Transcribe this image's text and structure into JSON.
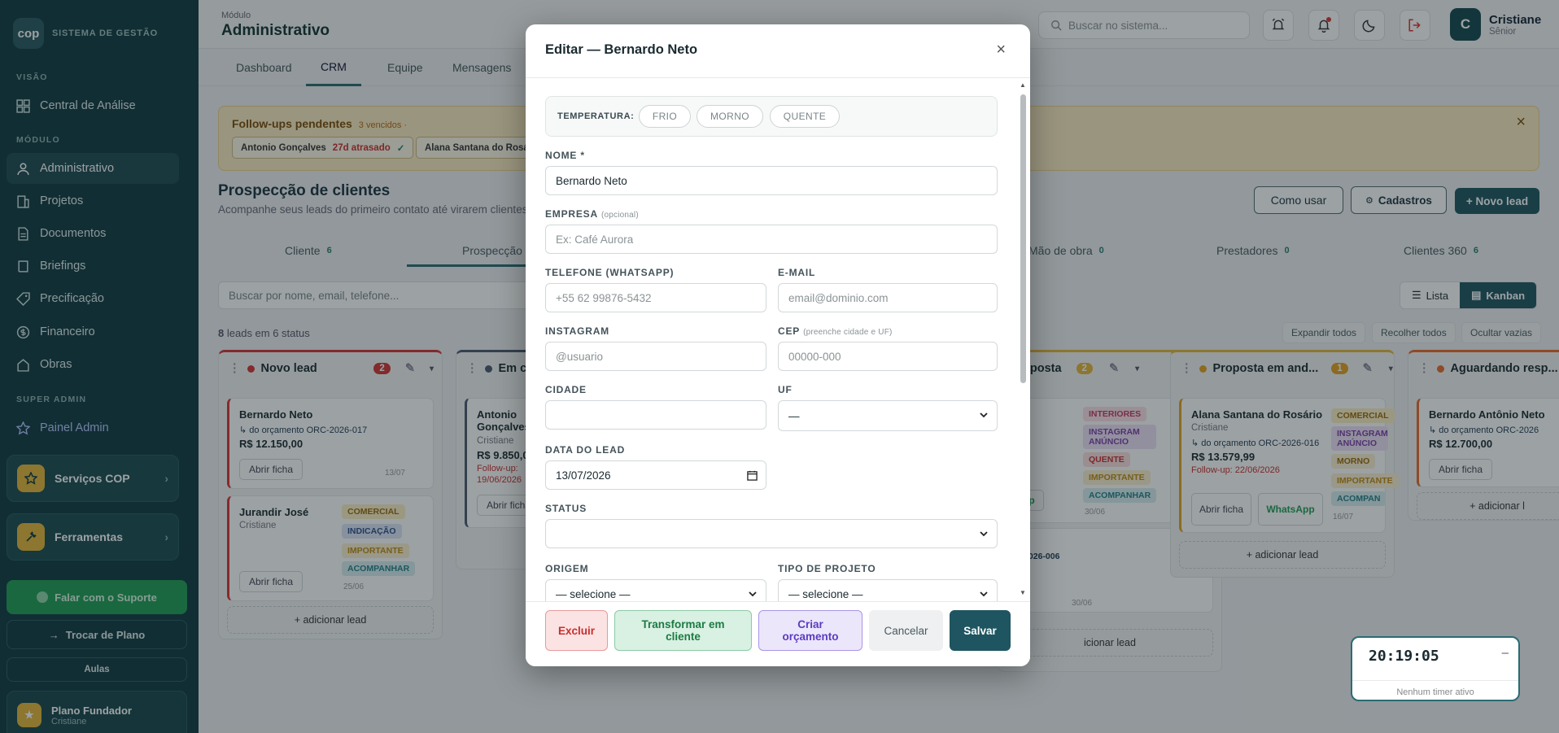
{
  "sidebar": {
    "logo": "cop",
    "logo_sub": "SISTEMA DE GESTÃO",
    "section_visao": "VISÃO",
    "section_modulo": "MÓDULO",
    "section_super": "SUPER ADMIN",
    "items": {
      "central": "Central de Análise",
      "administrativo": "Administrativo",
      "projetos": "Projetos",
      "documentos": "Documentos",
      "briefings": "Briefings",
      "precificacao": "Precificação",
      "financeiro": "Financeiro",
      "obras": "Obras",
      "painel_admin": "Painel Admin"
    },
    "servicos": "Serviços COP",
    "ferramentas": "Ferramentas",
    "suporte": "Falar com o Suporte",
    "trocar_plano": "Trocar de Plano",
    "aulas": "Aulas",
    "plano": "Plano Fundador",
    "plano_user": "Cristiane"
  },
  "topbar": {
    "module_label": "Módulo",
    "module_title": "Administrativo",
    "search_placeholder": "Buscar no sistema...",
    "user_initial": "C",
    "user_name": "Cristiane",
    "user_role": "Sênior"
  },
  "tabs": [
    "Dashboard",
    "CRM",
    "Equipe",
    "Mensagens"
  ],
  "banner": {
    "title": "Follow-ups pendentes",
    "count": "3 vencidos ·",
    "chip1_name": "Antonio Gonçalves",
    "chip1_late": "27d atrasado",
    "chip1_check": "✓",
    "chip2_name": "Alana Santana do Rosário"
  },
  "page": {
    "title": "Prospecção de clientes",
    "subtitle": "Acompanhe seus leads do primeiro contato até virarem clientes",
    "btn_como_usar": "Como usar",
    "btn_cadastros": "Cadastros",
    "btn_novo_lead": "+ Novo lead"
  },
  "stage_tabs": {
    "cliente": "Cliente",
    "cliente_n": "6",
    "prospeccao": "Prospecção",
    "mao_obra": "Mão de obra",
    "mao_obra_n": "0",
    "prestadores": "Prestadores",
    "prestadores_n": "0",
    "clientes360": "Clientes 360",
    "clientes360_n": "6"
  },
  "toolbar": {
    "lead_search": "Buscar por nome, email, telefone...",
    "lista": "Lista",
    "kanban": "Kanban",
    "leads_n": "8",
    "leads_text": "leads em 6 status",
    "expandir": "Expandir todos",
    "recolher": "Recolher todos",
    "ocultar": "Ocultar vazias"
  },
  "kanban": {
    "col1": {
      "title": "Novo lead",
      "count": "2",
      "card1": {
        "name": "Bernardo Neto",
        "origin": "↳ do orçamento ORC-2026-017",
        "value": "R$ 12.150,00",
        "btn": "Abrir ficha",
        "date": "13/07"
      },
      "card2": {
        "name": "Jurandir José",
        "owner": "Cristiane",
        "btn": "Abrir ficha",
        "date": "25/06",
        "tags": [
          "COMERCIAL",
          "INDICAÇÃO",
          "IMPORTANTE",
          "ACOMPANHAR"
        ]
      },
      "add": "+ adicionar lead"
    },
    "col2": {
      "title": "Em co",
      "card_name": "Antonio Gonçalves",
      "owner": "Cristiane",
      "value": "R$ 9.850,0",
      "followup": "Follow-up:",
      "followup_date": "19/06/2026",
      "btn": "Abrir ficha"
    },
    "col3": {
      "title": "oposta",
      "count": "2",
      "tags": [
        "INTERIORES",
        "INSTAGRAM ANÚNCIO",
        "QUENTE",
        "IMPORTANTE",
        "ACOMPANHAR"
      ],
      "btn": "App",
      "date": "30/06",
      "orc": "C-2026-006",
      "date2": "30/06",
      "add": "icionar lead"
    },
    "col4": {
      "title": "Proposta em and...",
      "count": "1",
      "card": {
        "name": "Alana Santana do Rosário",
        "owner": "Cristiane",
        "origin": "↳ do orçamento ORC-2026-016",
        "value": "R$ 13.579,99",
        "followup": "Follow-up: 22/06/2026",
        "btn": "Abrir ficha",
        "btn2": "WhatsApp",
        "date": "16/07",
        "tags": [
          "COMERCIAL",
          "INSTAGRAM ANÚNCIO",
          "MORNO",
          "IMPORTANTE",
          "ACOMPAN"
        ]
      },
      "add": "+ adicionar lead"
    },
    "col5": {
      "title": "Aguardando resp...",
      "card": {
        "name": "Bernardo Antônio Neto",
        "origin": "↳ do orçamento ORC-2026",
        "value": "R$ 12.700,00",
        "btn": "Abrir ficha"
      },
      "add": "+ adicionar l"
    }
  },
  "timer": {
    "time": "20:19:05",
    "status": "Nenhum timer ativo",
    "min": "–"
  },
  "modal": {
    "title": "Editar — Bernardo Neto",
    "close": "×",
    "temperatura_label": "TEMPERATURA:",
    "temp_frio": "FRIO",
    "temp_morno": "MORNO",
    "temp_quente": "QUENTE",
    "nome_label": "NOME *",
    "nome_value": "Bernardo Neto",
    "empresa_label": "EMPRESA",
    "empresa_hint": "(opcional)",
    "empresa_ph": "Ex: Café Aurora",
    "telefone_label": "TELEFONE (WHATSAPP)",
    "telefone_ph": "+55 62 99876-5432",
    "email_label": "E-MAIL",
    "email_ph": "email@dominio.com",
    "instagram_label": "INSTAGRAM",
    "instagram_ph": "@usuario",
    "cep_label": "CEP",
    "cep_hint": "(preenche cidade e UF)",
    "cep_ph": "00000-000",
    "cidade_label": "CIDADE",
    "uf_label": "UF",
    "uf_value": "—",
    "data_label": "DATA DO LEAD",
    "data_value": "13/07/2026",
    "status_label": "STATUS",
    "origem_label": "ORIGEM",
    "origem_value": "— selecione —",
    "tipo_label": "TIPO DE PROJETO",
    "tipo_value": "— selecione —",
    "btn_excluir": "Excluir",
    "btn_transformar": "Transformar em cliente",
    "btn_orcamento": "Criar orçamento",
    "btn_cancelar": "Cancelar",
    "btn_salvar": "Salvar"
  },
  "colors": {
    "sidebar": "#103a40",
    "accent": "#1e5560",
    "danger": "#d33535",
    "warning": "#e4b53a"
  }
}
